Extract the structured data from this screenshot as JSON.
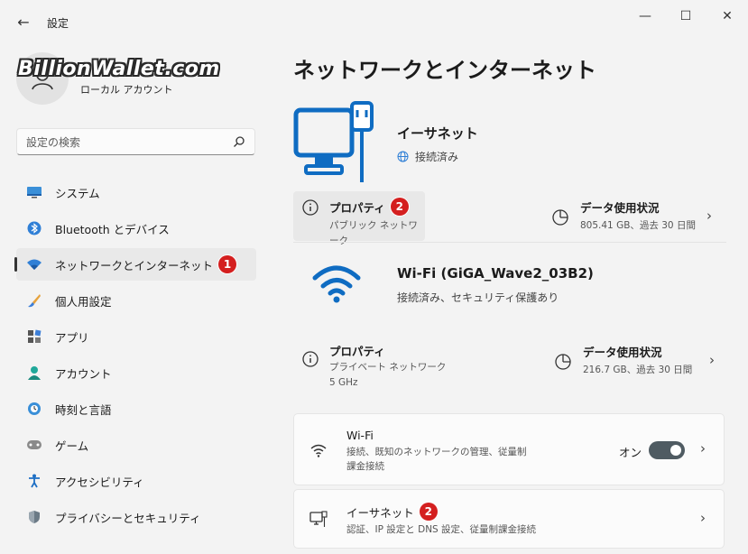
{
  "window": {
    "title": "設定",
    "back_glyph": "←",
    "minimize_glyph": "—",
    "maximize_glyph": "☐",
    "close_glyph": "✕"
  },
  "profile": {
    "watermark": "BillionWallet.com",
    "account_type": "ローカル アカウント"
  },
  "search": {
    "placeholder": "設定の検索"
  },
  "nav": {
    "items": [
      {
        "label": "システム",
        "icon": "system-icon"
      },
      {
        "label": "Bluetooth とデバイス",
        "icon": "bluetooth-icon"
      },
      {
        "label": "ネットワークとインターネット",
        "icon": "network-icon",
        "active": true,
        "badge": "1"
      },
      {
        "label": "個人用設定",
        "icon": "brush-icon"
      },
      {
        "label": "アプリ",
        "icon": "apps-icon"
      },
      {
        "label": "アカウント",
        "icon": "account-icon"
      },
      {
        "label": "時刻と言語",
        "icon": "time-language-icon"
      },
      {
        "label": "ゲーム",
        "icon": "gamepad-icon"
      },
      {
        "label": "アクセシビリティ",
        "icon": "accessibility-icon"
      },
      {
        "label": "プライバシーとセキュリティ",
        "icon": "shield-icon"
      }
    ]
  },
  "main": {
    "title": "ネットワークとインターネット",
    "ethernet": {
      "name": "イーサネット",
      "status": "接続済み",
      "properties": {
        "title": "プロパティ",
        "badge": "2",
        "sub": "パブリック ネットワーク"
      },
      "data_usage": {
        "title": "データ使用状況",
        "sub": "805.41 GB、過去 30 日間"
      }
    },
    "wifi": {
      "name": "Wi-Fi (GiGA_Wave2_03B2)",
      "status": "接続済み、セキュリティ保護あり",
      "properties": {
        "title": "プロパティ",
        "sub1": "プライベート ネットワーク",
        "sub2": "5 GHz"
      },
      "data_usage": {
        "title": "データ使用状況",
        "sub": "216.7 GB、過去 30 日間"
      }
    },
    "cards": {
      "wifi": {
        "title": "Wi-Fi",
        "sub1": "接続、既知のネットワークの管理、従量制",
        "sub2": "課金接続",
        "toggle_label": "オン",
        "toggle_on": true
      },
      "ethernet": {
        "title": "イーサネット",
        "badge": "2",
        "sub": "認証、IP 設定と DNS 設定、従量制課金接続"
      }
    },
    "chevron": "›"
  },
  "colors": {
    "accent": "#0067c0",
    "badge": "#d41f1f",
    "toggle": "#4f5b62",
    "background": "#f3f3f3"
  }
}
